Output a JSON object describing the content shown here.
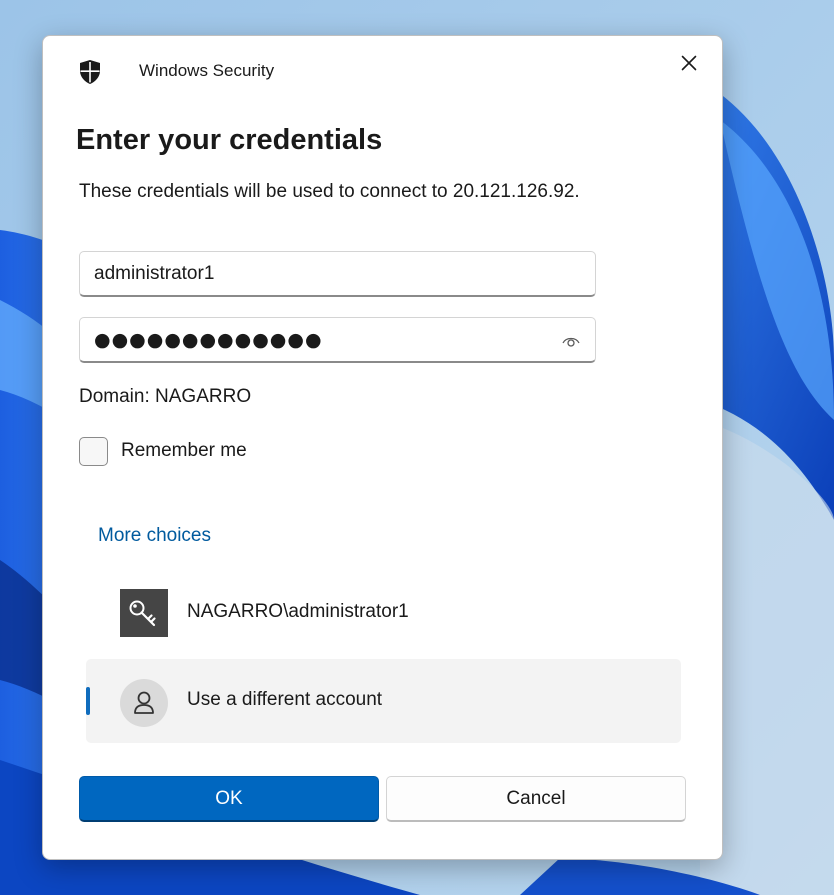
{
  "window": {
    "app_title": "Windows Security",
    "close_icon": "close-icon",
    "shield_icon": "shield-icon"
  },
  "form": {
    "heading": "Enter your credentials",
    "description": "These credentials will be used to connect to 20.121.126.92.",
    "username_value": "administrator1",
    "password_masked": "●●●●●●●●●●●●●",
    "reveal_icon": "eye-icon",
    "domain_text": "Domain: NAGARRO",
    "remember_label": "Remember me",
    "remember_checked": false
  },
  "choices": {
    "link_label": "More choices",
    "accounts": [
      {
        "label": "NAGARRO\\administrator1",
        "icon": "key-icon",
        "selected": false
      },
      {
        "label": "Use a different account",
        "icon": "person-icon",
        "selected": true
      }
    ]
  },
  "buttons": {
    "ok_label": "OK",
    "cancel_label": "Cancel"
  },
  "colors": {
    "accent": "#0067c0",
    "link": "#005a9e",
    "wallpaper": "#1e64d8"
  }
}
